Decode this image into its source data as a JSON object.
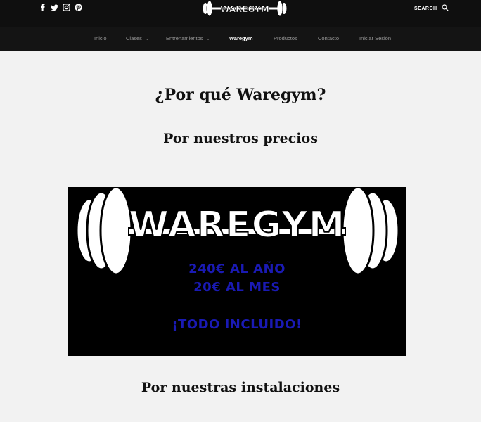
{
  "header": {
    "social": [
      "facebook-icon",
      "twitter-icon",
      "instagram-icon",
      "pinterest-icon"
    ],
    "logo_text": "WAREGYM",
    "search_label": "SEARCH"
  },
  "nav": {
    "items": [
      {
        "label": "Inicio"
      },
      {
        "label": "Clases"
      },
      {
        "label": "Entrenamientos"
      },
      {
        "label": "Waregym"
      },
      {
        "label": "Productos"
      },
      {
        "label": "Contacto"
      },
      {
        "label": "Iniciar Sesión"
      }
    ],
    "active": "Waregym"
  },
  "main": {
    "title": "¿Por qué Waregym?",
    "section1": "Por nuestros precios",
    "promo": {
      "brand": "WAREGYM",
      "line1": "240€ AL AÑO",
      "line2": "20€ AL MES",
      "line3": "¡TODO INCLUIDO!"
    },
    "section2": "Por nuestras instalaciones"
  },
  "colors": {
    "topbar": "#0f0f0f",
    "price_text": "#1a1ab4",
    "background": "#f2f2f2"
  }
}
